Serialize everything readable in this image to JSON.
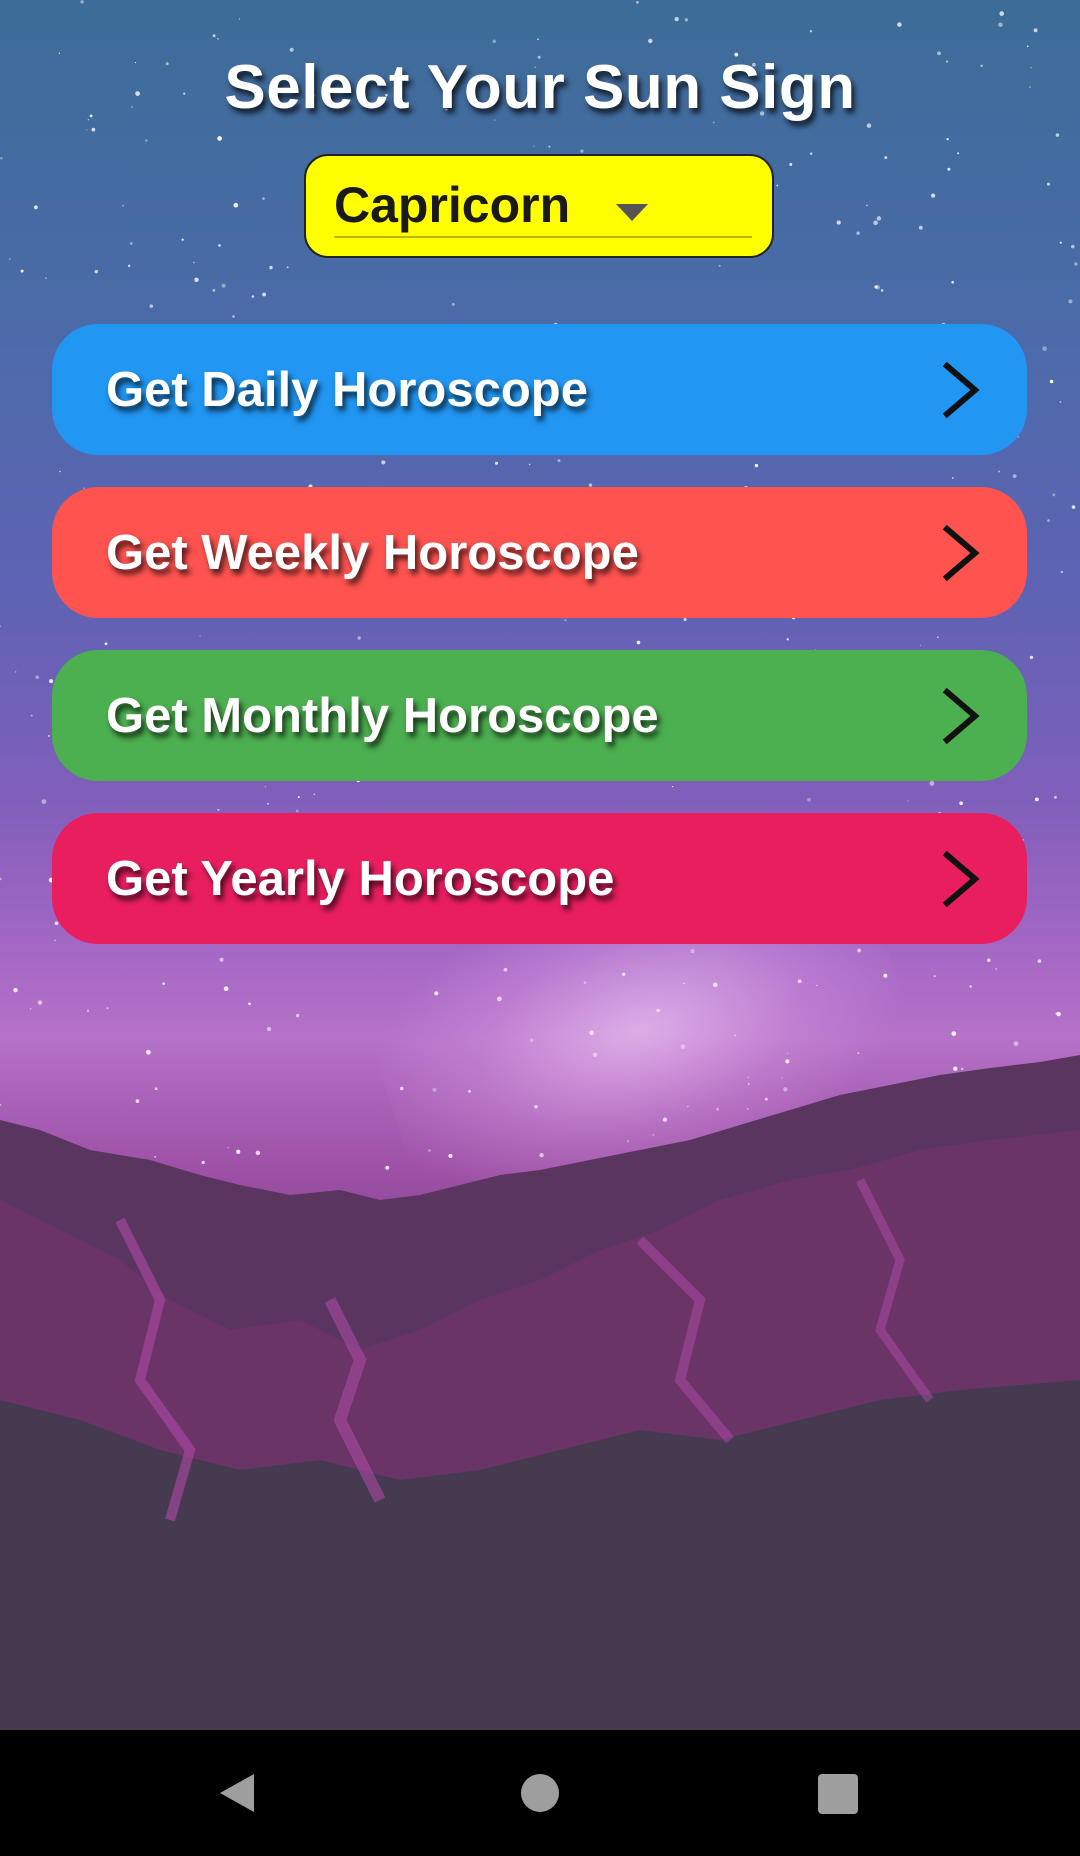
{
  "header": {
    "title": "Select Your Sun Sign"
  },
  "sign_selector": {
    "selected": "Capricorn",
    "caret_icon": "dropdown-arrow-icon",
    "background_color": "#ffff00"
  },
  "buttons": [
    {
      "label": "Get Daily Horoscope",
      "color": "#2196f3",
      "icon": "chevron-right-icon"
    },
    {
      "label": "Get Weekly Horoscope",
      "color": "#ff5350",
      "icon": "chevron-right-icon"
    },
    {
      "label": "Get Monthly Horoscope",
      "color": "#4caf50",
      "icon": "chevron-right-icon"
    },
    {
      "label": "Get Yearly Horoscope",
      "color": "#e91e5f",
      "icon": "chevron-right-icon"
    }
  ],
  "system_nav": {
    "back_icon": "back-triangle-icon",
    "home_icon": "home-circle-icon",
    "recents_icon": "recents-square-icon"
  }
}
